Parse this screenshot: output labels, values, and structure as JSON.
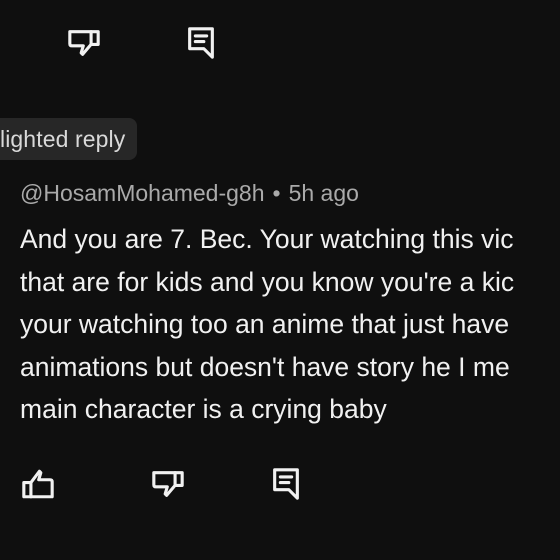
{
  "top_actions": {
    "dislike_icon": "thumbs-down-icon",
    "reply_icon": "reply-icon"
  },
  "highlight_badge": {
    "label": "lighted reply"
  },
  "comment": {
    "author": "@HosamMohamed-g8h",
    "separator": "•",
    "time": "5h ago",
    "lines": [
      "And you are 7. Bec. Your watching this vic",
      "that are for kids and you know you're a kic",
      "your watching too an anime that just have",
      "animations but doesn't have story he I me",
      "main character is a crying baby"
    ]
  },
  "bottom_actions": {
    "like_icon": "thumbs-up-icon",
    "dislike_icon": "thumbs-down-icon",
    "reply_icon": "reply-icon"
  }
}
